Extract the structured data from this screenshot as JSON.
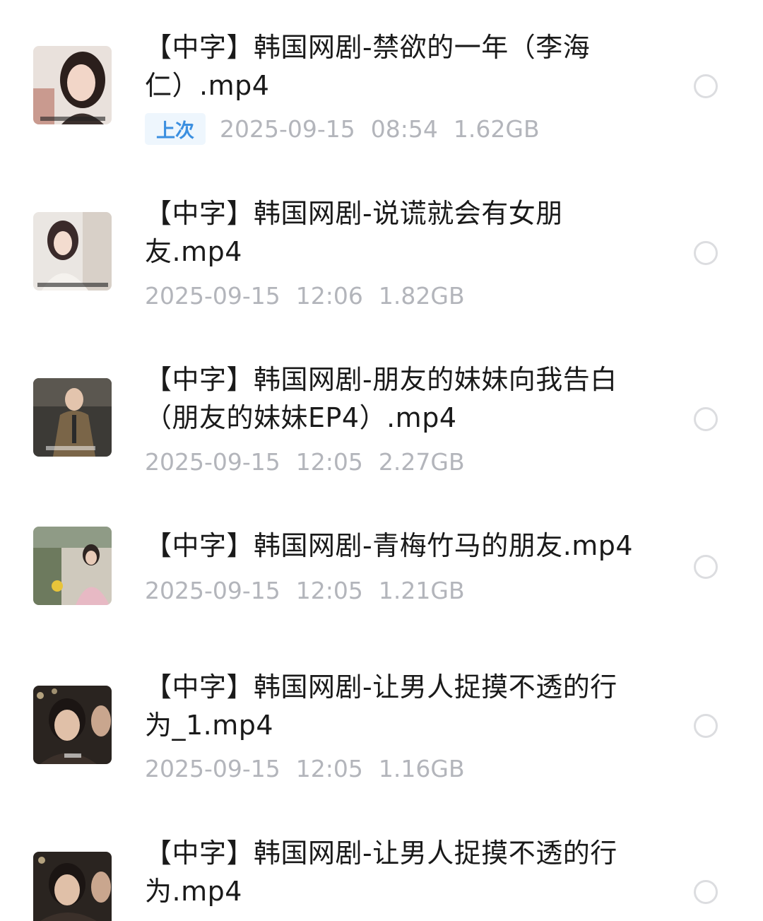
{
  "files": [
    {
      "title_line1": "【中字】韩国网剧-禁欲的一年（李海",
      "title_line2": "仁）.mp4",
      "tag": "上次",
      "date": "2025-09-15",
      "time": "08:54",
      "size": "1.62GB"
    },
    {
      "title_line1": "【中字】韩国网剧-说谎就会有女朋",
      "title_line2": "友.mp4",
      "date": "2025-09-15",
      "time": "12:06",
      "size": "1.82GB"
    },
    {
      "title_line1": "【中字】韩国网剧-朋友的妹妹向我告白",
      "title_line2": "（朋友的妹妹EP4）.mp4",
      "date": "2025-09-15",
      "time": "12:05",
      "size": "2.27GB"
    },
    {
      "title_line1": "【中字】韩国网剧-青梅竹马的朋友.mp4",
      "date": "2025-09-15",
      "time": "12:05",
      "size": "1.21GB"
    },
    {
      "title_line1": "【中字】韩国网剧-让男人捉摸不透的行",
      "title_line2": "为_1.mp4",
      "date": "2025-09-15",
      "time": "12:05",
      "size": "1.16GB"
    },
    {
      "title_line1": "【中字】韩国网剧-让男人捉摸不透的行",
      "title_line2": "为.mp4"
    }
  ],
  "colors": {
    "title": "#1a1a1a",
    "meta": "#b3b5bb",
    "tag_text": "#3b8fe0",
    "tag_bg": "#eef6fd",
    "radio_border": "#dcdde0"
  },
  "icons": {
    "select": "radio-circle-icon"
  }
}
